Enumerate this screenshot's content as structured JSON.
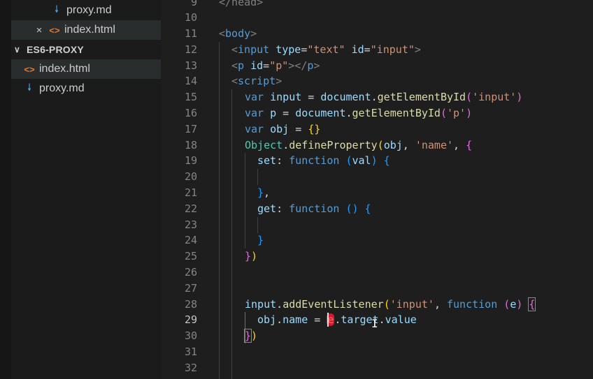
{
  "explorer": {
    "open_editors": [
      {
        "name": "proxy.md",
        "type": "md"
      },
      {
        "name": "index.html",
        "type": "html",
        "close_icon": "×"
      }
    ],
    "folder": {
      "name": "ES6-PROXY",
      "expanded": true
    },
    "files": [
      {
        "name": "index.html",
        "type": "html",
        "active": true
      },
      {
        "name": "proxy.md",
        "type": "md"
      }
    ]
  },
  "editor": {
    "line_numbers": [
      "9",
      "10",
      "11",
      "12",
      "13",
      "14",
      "15",
      "16",
      "17",
      "18",
      "19",
      "20",
      "21",
      "22",
      "23",
      "24",
      "25",
      "26",
      "27",
      "28",
      "29",
      "30",
      "31",
      "32"
    ],
    "current_line": "29",
    "code": {
      "l9": "</head>",
      "l11_tag": "body",
      "l12_tag": "input",
      "l12_a1": "type",
      "l12_v1": "\"text\"",
      "l12_a2": "id",
      "l12_v2": "\"input\"",
      "l13_tag": "p",
      "l13_a1": "id",
      "l13_v1": "\"p\"",
      "l14_tag": "script",
      "kw_var": "var",
      "kw_function": "function",
      "v_input": "input",
      "v_p": "p",
      "v_obj": "obj",
      "v_document": "document",
      "fn_getById": "getElementById",
      "s_input": "'input'",
      "s_p": "'p'",
      "s_name": "'name'",
      "cls_object": "Object",
      "fn_defineProperty": "defineProperty",
      "prop_set": "set",
      "prop_get": "get",
      "param_val": "val",
      "param_e": "e",
      "fn_addEventListener": "addEventListener",
      "prop_name": "name",
      "prop_target": "target",
      "prop_value": "value"
    }
  },
  "colors": {
    "editor_bg": "#1e1e1e",
    "sidebar_bg": "#1b1b1c",
    "selection_highlight": "#d5192e"
  }
}
